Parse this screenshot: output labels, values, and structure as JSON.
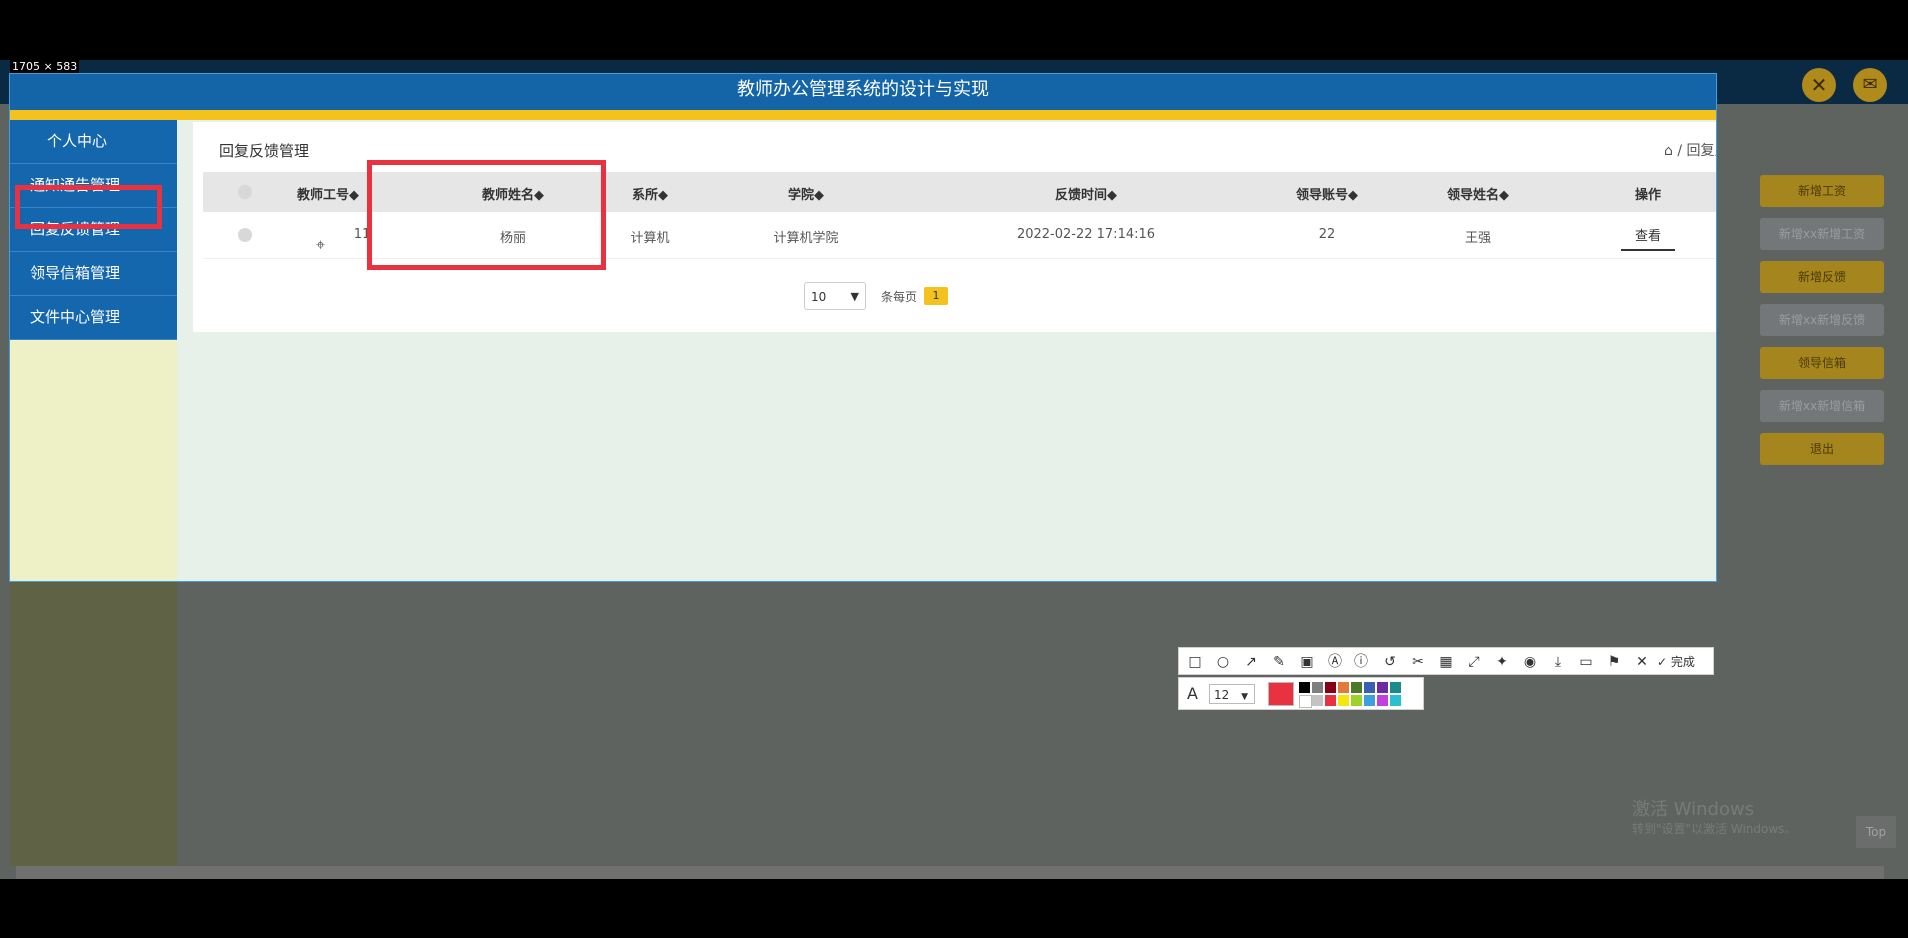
{
  "capture": {
    "size_label": "1705 × 583"
  },
  "app": {
    "title": "教师办公管理系统的设计与实现",
    "header_right_icons": [
      "close-circle-icon",
      "mail-icon"
    ],
    "right_buttons": [
      "新增工资",
      "新增xx新增工资",
      "新增反馈",
      "新增xx新增反馈",
      "领导信箱",
      "新增xx新增信箱",
      "退出"
    ]
  },
  "sidebar": {
    "items": [
      {
        "label": "个人中心"
      },
      {
        "label": "通知通告管理"
      },
      {
        "label": "回复反馈管理"
      },
      {
        "label": "领导信箱管理"
      },
      {
        "label": "文件中心管理"
      }
    ]
  },
  "main": {
    "title": "回复反馈管理",
    "breadcrumb": "⌂ / 回复反馈管理 / 回复反馈列表",
    "table": {
      "headers": [
        "教师工号◆",
        "教师姓名◆",
        "系所◆",
        "学院◆",
        "反馈时间◆",
        "领导账号◆",
        "领导姓名◆",
        "操作"
      ],
      "rows": [
        {
          "teacher_id": "11",
          "teacher_name": "杨丽",
          "dept": "计算机",
          "college": "计算机学院",
          "time": "2022-02-22 17:14:16",
          "leader_account": "22",
          "leader_name": "王强",
          "action": "查看"
        }
      ]
    },
    "pager": {
      "page_size": "10",
      "per_page_label": "条每页",
      "current_page": "1"
    }
  },
  "overlay": {
    "watermark_line1": "激活 Windows",
    "watermark_line2": "转到\"设置\"以激活 Windows。",
    "top_button": "Top"
  },
  "annotation_toolbar": {
    "tools": [
      "rectangle-icon",
      "ellipse-icon",
      "arrow-icon",
      "pencil-icon",
      "mosaic-icon",
      "text-icon",
      "number-icon",
      "undo-icon",
      "crop-icon",
      "ocr-icon",
      "expand-icon",
      "pin-icon",
      "record-icon",
      "download-icon",
      "save-icon",
      "bookmark-icon",
      "close-icon"
    ],
    "done_label": "完成",
    "font_size": "12",
    "current_color": "#e8323f",
    "palette_top": [
      "#000000",
      "#7f7f7f",
      "#880015",
      "#e07b39",
      "#4a7a2a",
      "#3b5fb0",
      "#6a2ca0",
      "#1a8a8a"
    ],
    "palette_bottom": [
      "#ffffff",
      "#c3c3c3",
      "#e8323f",
      "#f5e60f",
      "#9fd12b",
      "#3aa0e0",
      "#c040e0",
      "#2ac0d0"
    ]
  },
  "colors": {
    "header": "#1365a8",
    "gold": "#f3c21f",
    "highlight": "#e8323f"
  }
}
